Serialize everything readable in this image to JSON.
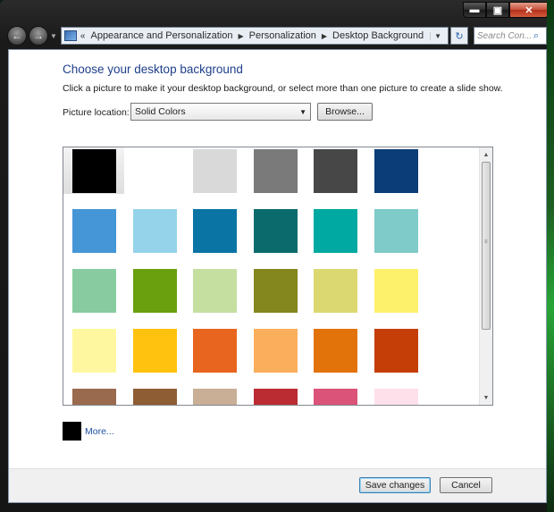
{
  "window": {
    "caption_buttons": {
      "minimize": "▬",
      "maximize": "▣",
      "close": "✕"
    }
  },
  "navbar": {
    "back_icon": "←",
    "forward_icon": "→",
    "breadcrumb_lead": "«",
    "breadcrumbs": [
      "Appearance and Personalization",
      "Personalization",
      "Desktop Background"
    ],
    "search_placeholder": "Search Con...",
    "search_icon": "⌕",
    "refresh_icon": "↻"
  },
  "page": {
    "title": "Choose your desktop background",
    "subtitle": "Click a picture to make it your desktop background, or select more than one picture to create a slide show.",
    "location_label": "Picture location:",
    "location_value": "Solid Colors",
    "browse_label": "Browse..."
  },
  "swatches": [
    [
      "#000000",
      "#ffffff",
      "#d9d9d9",
      "#7a7a7a",
      "#474747",
      "#0b3d78"
    ],
    [
      "#4496d6",
      "#94d3ea",
      "#0a74a4",
      "#0b6b6c",
      "#00a9a1",
      "#7ecbc9"
    ],
    [
      "#88cba0",
      "#6aa00e",
      "#c4dfa0",
      "#84861e",
      "#dbd771",
      "#fdf16b"
    ],
    [
      "#fef7a0",
      "#ffc20e",
      "#e8651f",
      "#fbae5c",
      "#e2720a",
      "#c53e07"
    ],
    [
      "#9a6a4e",
      "#8f5d34",
      "#c8af96",
      "#ba2c32",
      "#db5378",
      "#fde0ea"
    ]
  ],
  "selected_swatch": "#000000",
  "more": {
    "label": "More...",
    "color": "#000000"
  },
  "footer": {
    "save_label": "Save changes",
    "cancel_label": "Cancel"
  }
}
